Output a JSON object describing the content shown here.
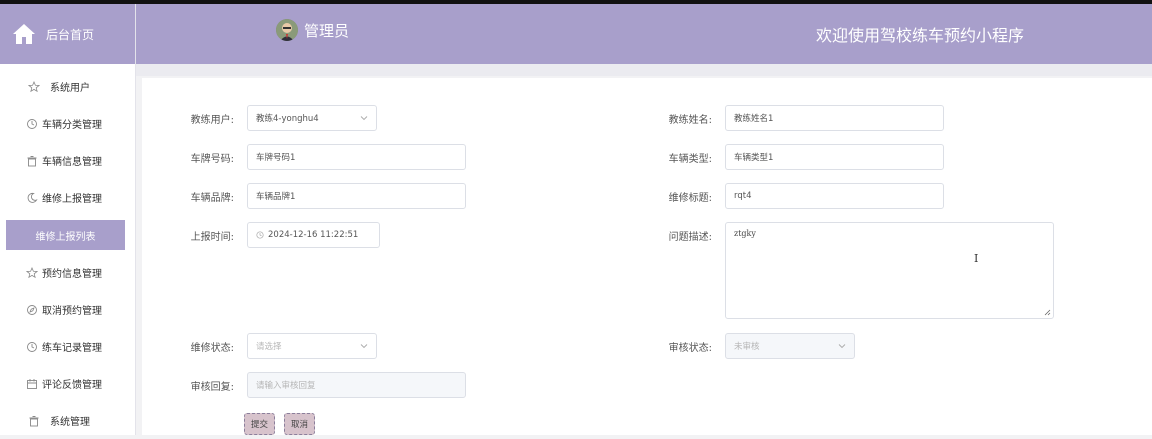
{
  "sidebar": {
    "home_label": "后台首页",
    "items": [
      {
        "label": "系统用户",
        "icon": "star-icon"
      },
      {
        "label": "车辆分类管理",
        "icon": "clock-icon"
      },
      {
        "label": "车辆信息管理",
        "icon": "trash-icon"
      },
      {
        "label": "维修上报管理",
        "icon": "moon-icon"
      },
      {
        "label": "维修上报列表",
        "icon": ""
      },
      {
        "label": "预约信息管理",
        "icon": "star-icon"
      },
      {
        "label": "取消预约管理",
        "icon": "compass-icon"
      },
      {
        "label": "练车记录管理",
        "icon": "clock-icon"
      },
      {
        "label": "评论反馈管理",
        "icon": "calendar-icon"
      },
      {
        "label": "系统管理",
        "icon": "trash-icon"
      }
    ]
  },
  "header": {
    "admin_name": "管理员",
    "welcome": "欢迎使用驾校练车预约小程序"
  },
  "form": {
    "coach_user": {
      "label": "教练用户:",
      "value": "教练4-yonghu4"
    },
    "coach_name": {
      "label": "教练姓名:",
      "value": "教练姓名1"
    },
    "plate_number": {
      "label": "车牌号码:",
      "value": "车牌号码1"
    },
    "vehicle_type": {
      "label": "车辆类型:",
      "value": "车辆类型1"
    },
    "vehicle_brand": {
      "label": "车辆品牌:",
      "value": "车辆品牌1"
    },
    "repair_title": {
      "label": "维修标题:",
      "value": "rqt4"
    },
    "report_time": {
      "label": "上报时间:",
      "value": "2024-12-16 11:22:51"
    },
    "problem_desc": {
      "label": "问题描述:",
      "value": "ztgky"
    },
    "repair_status": {
      "label": "维修状态:",
      "placeholder": "请选择"
    },
    "audit_status": {
      "label": "审核状态:",
      "placeholder": "未审核"
    },
    "audit_reply": {
      "label": "审核回复:",
      "placeholder": "请输入审核回复"
    },
    "submit_label": "提交",
    "cancel_label": "取消"
  },
  "colors": {
    "accent": "#a89fcb",
    "button_bg": "#d7c3cc"
  }
}
